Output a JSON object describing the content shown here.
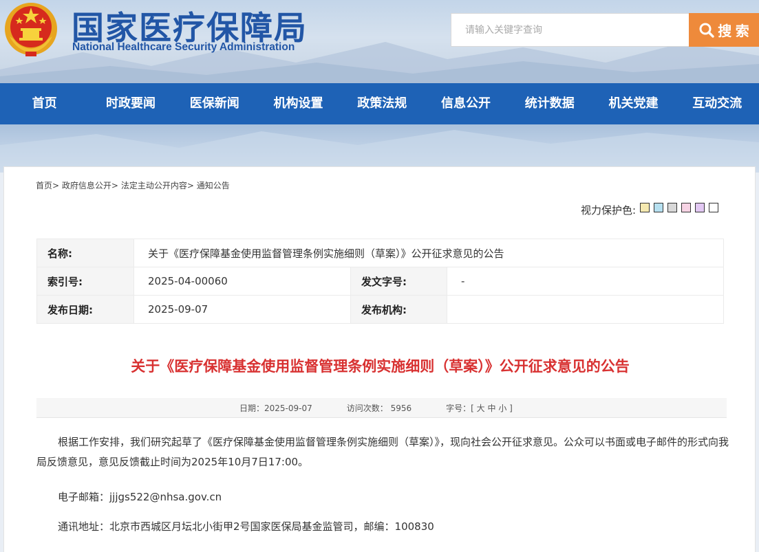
{
  "header": {
    "title_cn": "国家医疗保障局",
    "title_en": "National Healthcare Security Administration",
    "search_placeholder": "请输入关键字查询",
    "search_label": "搜 索"
  },
  "nav": [
    {
      "label": "首页"
    },
    {
      "label": "时政要闻"
    },
    {
      "label": "医保新闻"
    },
    {
      "label": "机构设置"
    },
    {
      "label": "政策法规"
    },
    {
      "label": "信息公开"
    },
    {
      "label": "统计数据"
    },
    {
      "label": "机关党建"
    },
    {
      "label": "互动交流"
    }
  ],
  "breadcrumb": [
    {
      "label": "首页",
      "sep": ">"
    },
    {
      "label": "政府信息公开",
      "sep": ">"
    },
    {
      "label": "法定主动公开内容",
      "sep": ">"
    },
    {
      "label": "通知公告",
      "sep": ""
    }
  ],
  "eyecare": {
    "label": "视力保护色:",
    "colors": [
      "#f5e9b0",
      "#b6e0f0",
      "#d8d8d8",
      "#f6d3e4",
      "#e2c8f3",
      "#ffffff"
    ]
  },
  "info": {
    "name_label": "名称:",
    "name_value": "关于《医疗保障基金使用监督管理条例实施细则（草案）》公开征求意见的公告",
    "index_label": "索引号:",
    "index_value": "2025-04-00060",
    "docno_label": "发文字号:",
    "docno_value": "-",
    "date_label": "发布日期:",
    "date_value": "2025-09-07",
    "org_label": "发布机构:",
    "org_value": ""
  },
  "article": {
    "title": "关于《医疗保障基金使用监督管理条例实施细则（草案）》公开征求意见的公告",
    "meta_date": "日期：2025-09-07",
    "meta_visits": "访问次数：  5956",
    "meta_font_label": "字号：[",
    "meta_font_options": [
      "大",
      "中",
      "小"
    ],
    "meta_font_close": "]",
    "para1": "根据工作安排，我们研究起草了《医疗保障基金使用监督管理条例实施细则（草案）》，现向社会公开征求意见。公众可以书面或电子邮件的形式向我局反馈意见，意见反馈截止时间为2025年10月7日17:00。",
    "para2": "电子邮箱：jjjgs522@nhsa.gov.cn",
    "para3": "通讯地址：北京市西城区月坛北小街甲2号国家医保局基金监管司，邮编：100830"
  }
}
